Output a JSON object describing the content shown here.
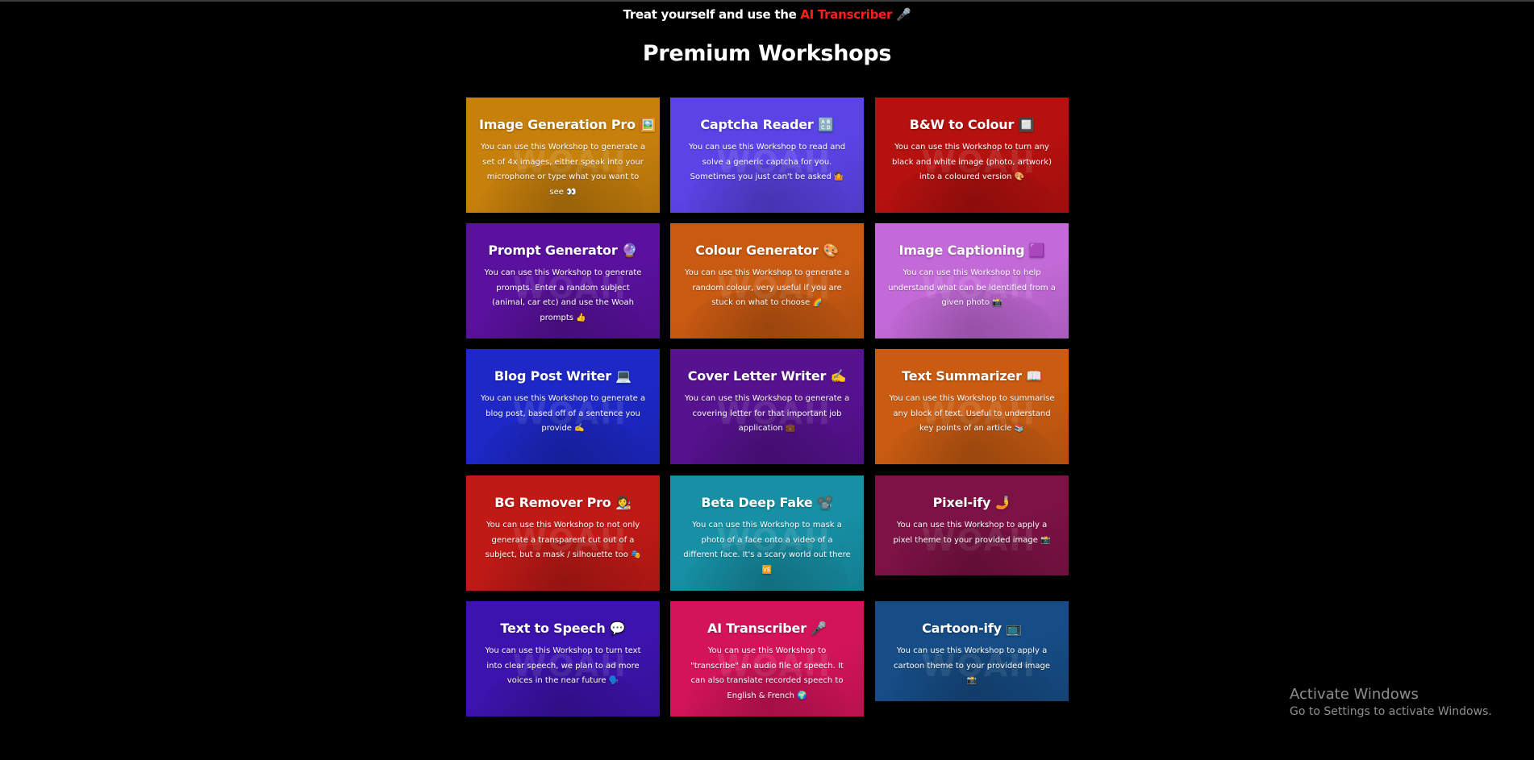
{
  "banner": {
    "prefix": "Treat yourself and use the ",
    "highlight": "AI Transcriber",
    "suffix": " 🎤"
  },
  "heading": "Premium Workshops",
  "workshops": [
    {
      "title": "Image Generation Pro 🖼️",
      "desc": "You can use this Workshop to generate a set of 4x images, either speak into your microphone or type what you want to see 👀",
      "color": "#c7800c"
    },
    {
      "title": "Captcha Reader 🔠",
      "desc": "You can use this Workshop to read and solve a generic captcha for you. Sometimes you just can't be asked 🤷",
      "color": "#5a44e6"
    },
    {
      "title": "B&W to Colour 🔲",
      "desc": "You can use this Workshop to turn any black and white image (photo, artwork) into a coloured version 🎨",
      "color": "#b5110f"
    },
    {
      "title": "Prompt Generator 🔮",
      "desc": "You can use this Workshop to generate prompts. Enter a random subject (animal, car etc) and use the Woah prompts 👍",
      "color": "#5a119e"
    },
    {
      "title": "Colour Generator 🎨",
      "desc": "You can use this Workshop to generate a random colour, very useful if you are stuck on what to choose 🌈",
      "color": "#c95a12"
    },
    {
      "title": "Image Captioning 🟪",
      "desc": "You can use this Workshop to help understand what can be identified from a given photo 📸",
      "color": "#c36ad8"
    },
    {
      "title": "Blog Post Writer 💻",
      "desc": "You can use this Workshop to generate a blog post, based off of a sentence you provide ✍️",
      "color": "#1d28c7"
    },
    {
      "title": "Cover Letter Writer ✍️",
      "desc": "You can use this Workshop to generate a covering letter for that important job application 💼",
      "color": "#571290"
    },
    {
      "title": "Text Summarizer 📖",
      "desc": "You can use this Workshop to summarise any block of text. Useful to understand key points of an article 📚",
      "color": "#c95c12"
    },
    {
      "title": "BG Remover Pro 👩‍🎨",
      "desc": "You can use this Workshop to not only generate a transparent cut out of a subject, but a mask / silhouette too 🎭",
      "color": "#c01a16"
    },
    {
      "title": "Beta Deep Fake 📽️",
      "desc": "You can use this Workshop to mask a photo of a face onto a video of a different face. It's a scary world out there 🆚",
      "color": "#1790a5"
    },
    {
      "title": "Pixel-ify 🤳",
      "desc": "You can use this Workshop to apply a pixel theme to your provided image 📸",
      "color": "#7d1245"
    },
    {
      "title": "Text to Speech 💬",
      "desc": "You can use this Workshop to turn text into clear speech, we plan to ad more voices in the near future 🗣️",
      "color": "#3d13ad"
    },
    {
      "title": "AI Transcriber 🎤",
      "desc": "You can use this Workshop to \"transcribe\" an audio file of speech. It can also translate recorded speech to English & French 🌍",
      "color": "#d4145a"
    },
    {
      "title": "Cartoon-ify 📺",
      "desc": "You can use this Workshop to apply a cartoon theme to your provided image 📸",
      "color": "#164d86"
    }
  ],
  "windows_notice": {
    "title": "Activate Windows",
    "subtitle": "Go to Settings to activate Windows."
  }
}
